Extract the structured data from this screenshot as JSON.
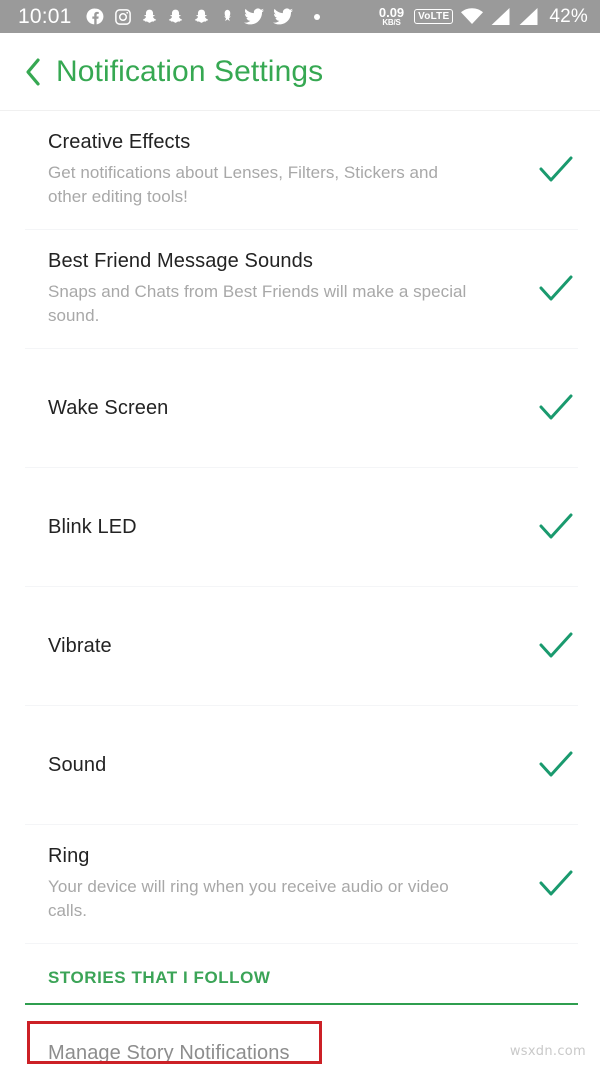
{
  "statusbar": {
    "clock": "10:01",
    "icons": [
      "facebook-icon",
      "instagram-icon",
      "snapchat-icon",
      "snapchat-icon",
      "snapchat-icon",
      "snapchat-ghost-icon",
      "twitter-icon",
      "twitter-icon",
      "more-dot-icon"
    ],
    "data_rate": "0.09",
    "data_rate_unit": "KB/S",
    "volte_label": "VoLTE",
    "wifi_icon": "wifi-icon",
    "signal_icon_1": "signal-bars-icon",
    "signal_icon_2": "signal-bars-icon",
    "battery": "42%",
    "background_color": "#9a9a9a"
  },
  "header": {
    "back_icon": "chevron-left-icon",
    "title": "Notification Settings",
    "accent_color": "#36a852"
  },
  "settings": {
    "rows": [
      {
        "title": "Creative Effects",
        "subtitle": "Get notifications about Lenses, Filters, Stickers and other editing tools!",
        "checked": true
      },
      {
        "title": "Best Friend Message Sounds",
        "subtitle": "Snaps and Chats from Best Friends will make a special sound.",
        "checked": true
      },
      {
        "title": "Wake Screen",
        "subtitle": "",
        "checked": true
      },
      {
        "title": "Blink LED",
        "subtitle": "",
        "checked": true
      },
      {
        "title": "Vibrate",
        "subtitle": "",
        "checked": true
      },
      {
        "title": "Sound",
        "subtitle": "",
        "checked": true
      },
      {
        "title": "Ring",
        "subtitle": "Your device will ring when you receive audio or video calls.",
        "checked": true
      }
    ],
    "check_color": "#1a9a6e"
  },
  "stories_section": {
    "header": "STORIES THAT I FOLLOW",
    "header_color": "#3ba457",
    "rule_color": "#2f9e4f",
    "manage_label": "Manage Story Notifications",
    "highlight_color": "#cc2026"
  },
  "watermark": "wsxdn.com"
}
